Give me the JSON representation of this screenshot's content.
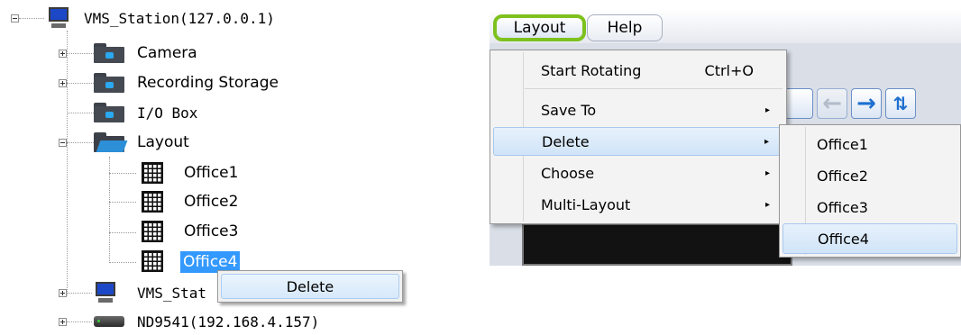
{
  "tree": {
    "root": {
      "label": "VMS_Station(127.0.0.1)",
      "icon": "monitor-icon"
    },
    "children": [
      {
        "label": "Camera",
        "icon": "camera-folder-icon"
      },
      {
        "label": "Recording Storage",
        "icon": "storage-folder-icon"
      },
      {
        "label": "I/O Box",
        "icon": "io-box-folder-icon"
      },
      {
        "label": "Layout",
        "icon": "open-folder-icon"
      }
    ],
    "layouts": [
      "Office1",
      "Office2",
      "Office3",
      "Office4"
    ],
    "selected": "Office4",
    "station2": {
      "label": "VMS_Stat",
      "icon": "monitor-icon"
    },
    "nvr": {
      "label": "ND9541(192.168.4.157)",
      "icon": "nvr-device-icon"
    },
    "context_menu": {
      "delete_label": "Delete"
    }
  },
  "menubar": {
    "layout": "Layout",
    "help": "Help",
    "highlight_color": "#7dc11e"
  },
  "layout_menu": {
    "items": [
      {
        "label": "Start Rotating",
        "shortcut": "Ctrl+O",
        "submenu": false
      },
      {
        "label": "Save To",
        "shortcut": "",
        "submenu": true
      },
      {
        "label": "Delete",
        "shortcut": "",
        "submenu": true
      },
      {
        "label": "Choose",
        "shortcut": "",
        "submenu": true
      },
      {
        "label": "Multi-Layout",
        "shortcut": "",
        "submenu": true
      }
    ],
    "chevron": "▸"
  },
  "delete_submenu": {
    "items": [
      "Office1",
      "Office2",
      "Office3",
      "Office4"
    ],
    "highlighted": "Office4"
  },
  "toolbar": {
    "back": "←",
    "forward": "→"
  }
}
